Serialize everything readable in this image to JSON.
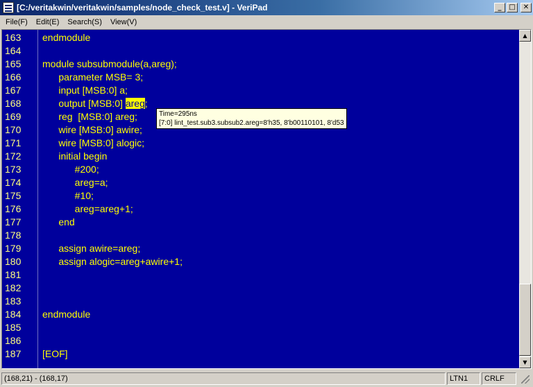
{
  "window": {
    "title": "[C:/veritakwin/veritakwin/samples/node_check_test.v] - VeriPad",
    "min_glyph": "_",
    "max_glyph": "□",
    "close_glyph": "✕"
  },
  "menu": [
    {
      "label": "File(F)"
    },
    {
      "label": "Edit(E)"
    },
    {
      "label": "Search(S)"
    },
    {
      "label": "View(V)"
    }
  ],
  "editor": {
    "lines": [
      {
        "num": "163",
        "text": "endmodule"
      },
      {
        "num": "164",
        "text": ""
      },
      {
        "num": "165",
        "text": "module subsubmodule(a,areg);"
      },
      {
        "num": "166",
        "text": "      parameter MSB= 3;"
      },
      {
        "num": "167",
        "text": "      input [MSB:0] a;"
      },
      {
        "num": "168",
        "text_before": "      output [MSB:0] ",
        "highlight": "areg",
        "text_after": ";"
      },
      {
        "num": "169",
        "text": "      reg  [MSB:0] areg;"
      },
      {
        "num": "170",
        "text": "      wire [MSB:0] awire;"
      },
      {
        "num": "171",
        "text": "      wire [MSB:0] alogic;"
      },
      {
        "num": "172",
        "text": "      initial begin"
      },
      {
        "num": "173",
        "text": "            #200;"
      },
      {
        "num": "174",
        "text": "            areg=a;"
      },
      {
        "num": "175",
        "text": "            #10;"
      },
      {
        "num": "176",
        "text": "            areg=areg+1;"
      },
      {
        "num": "177",
        "text": "      end"
      },
      {
        "num": "178",
        "text": ""
      },
      {
        "num": "179",
        "text": "      assign awire=areg;"
      },
      {
        "num": "180",
        "text": "      assign alogic=areg+awire+1;"
      },
      {
        "num": "181",
        "text": ""
      },
      {
        "num": "182",
        "text": ""
      },
      {
        "num": "183",
        "text": ""
      },
      {
        "num": "184",
        "text": "endmodule"
      },
      {
        "num": "185",
        "text": ""
      },
      {
        "num": "186",
        "text": ""
      },
      {
        "num": "187",
        "text": "[EOF]"
      }
    ],
    "colors": {
      "background": "#00009c",
      "text": "#ffff00",
      "line_number": "#ffff80",
      "highlight": "#ffff00"
    }
  },
  "tooltip": {
    "line1": "Time=295ns",
    "line2": "[7:0] lint_test.sub3.subsub2.areg=8'h35, 8'b00110101, 8'd53"
  },
  "scrollbar": {
    "up_glyph": "▲",
    "down_glyph": "▼"
  },
  "status": {
    "position": "(168,21) - (168,17)",
    "mode": "LTN1",
    "eol": "CRLF"
  }
}
